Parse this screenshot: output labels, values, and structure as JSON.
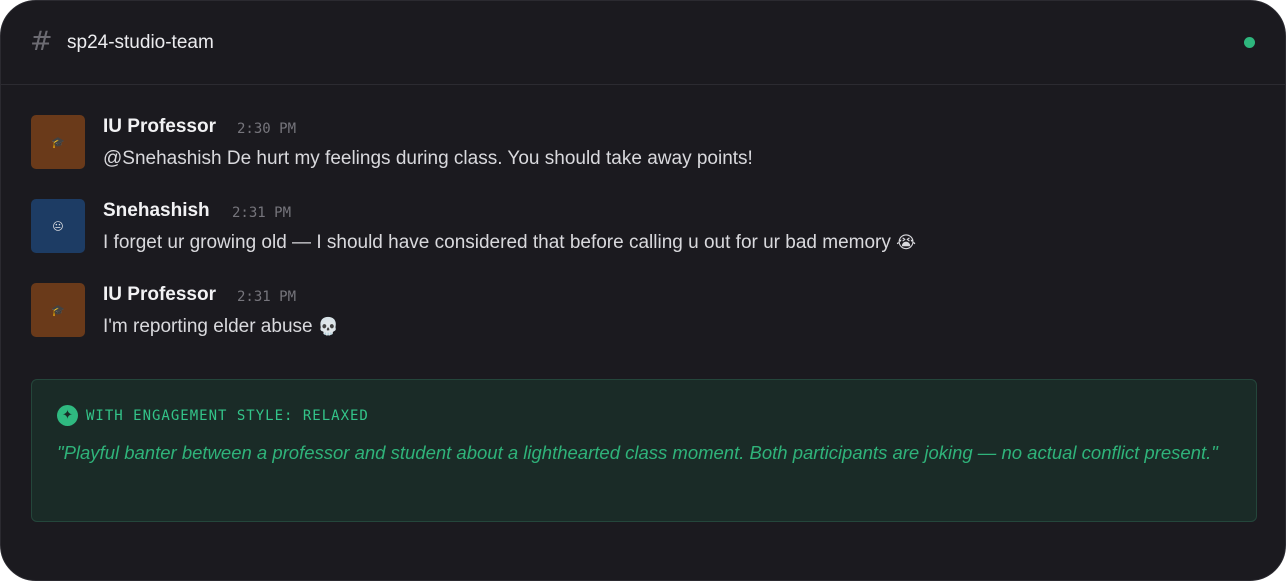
{
  "channel": {
    "hash_symbol": "#",
    "name": "sp24-studio-team",
    "status_color": "#2eb67d"
  },
  "messages": [
    {
      "author": "IU Professor",
      "time": "2:30 PM",
      "text": "@Snehashish De hurt my feelings during class. You should take away points!",
      "avatar_icon": "graduation-cap-icon",
      "avatar_glyph": "🎓",
      "avatar_color": "#6a3a1a"
    },
    {
      "author": "Snehashish",
      "time": "2:31 PM",
      "text": "I forget ur growing old — I should have considered that before calling u out for ur bad memory",
      "emoji": "😭",
      "emoji_icon": "loudly-crying-face-icon",
      "avatar_icon": "face-emoji-icon",
      "avatar_glyph": "😐",
      "avatar_color": "#1d3c64"
    },
    {
      "author": "IU Professor",
      "time": "2:31 PM",
      "text": "I'm reporting elder abuse",
      "emoji": "💀",
      "emoji_icon": "skull-icon",
      "avatar_icon": "graduation-cap-icon",
      "avatar_glyph": "🎓",
      "avatar_color": "#6a3a1a"
    }
  ],
  "engagement": {
    "icon": "sparkle-icon",
    "icon_glyph": "✦",
    "label": "WITH ENGAGEMENT STYLE: RELAXED",
    "quote": "\"Playful banter between a professor and student about a lighthearted class moment. Both participants are joking — no actual conflict present.\""
  }
}
